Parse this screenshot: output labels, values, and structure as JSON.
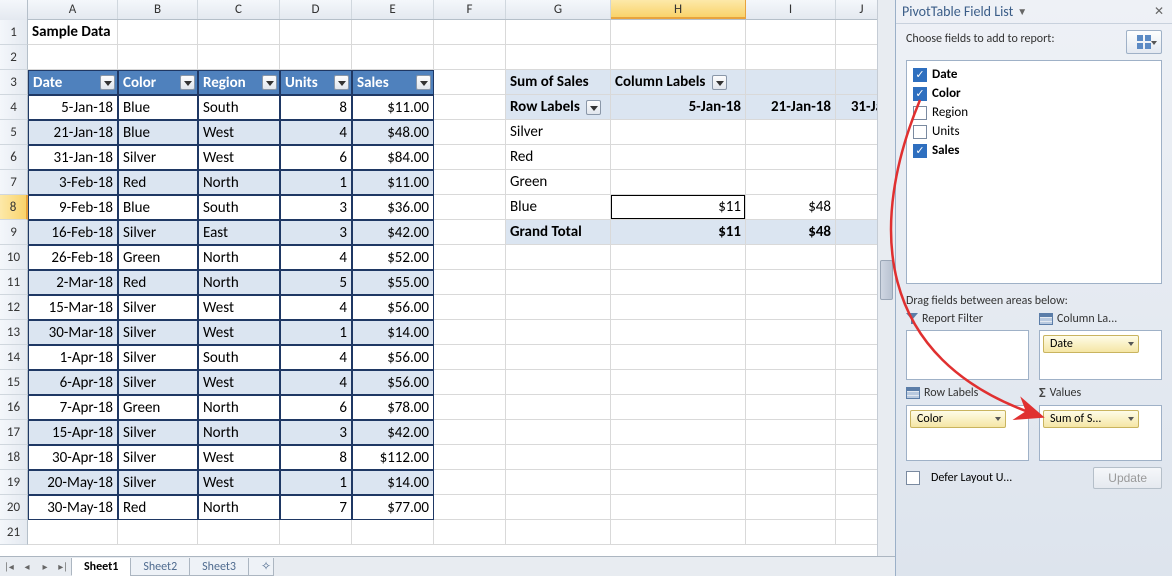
{
  "columns": [
    {
      "l": "A",
      "w": 90
    },
    {
      "l": "B",
      "w": 80
    },
    {
      "l": "C",
      "w": 82
    },
    {
      "l": "D",
      "w": 72
    },
    {
      "l": "E",
      "w": 82
    },
    {
      "l": "F",
      "w": 72
    },
    {
      "l": "G",
      "w": 105,
      "pv": true
    },
    {
      "l": "H",
      "w": 135,
      "pv": true,
      "selected": true
    },
    {
      "l": "I",
      "w": 90,
      "pv": true
    },
    {
      "l": "J",
      "w": 52,
      "pv": true
    }
  ],
  "title_cell": "Sample Data",
  "table": {
    "headers": [
      "Date",
      "Color",
      "Region",
      "Units",
      "Sales"
    ],
    "rows": [
      {
        "date": "5-Jan-18",
        "color": "Blue",
        "region": "South",
        "units": "8",
        "sales": "$11.00",
        "alt": false
      },
      {
        "date": "21-Jan-18",
        "color": "Blue",
        "region": "West",
        "units": "4",
        "sales": "$48.00",
        "alt": true
      },
      {
        "date": "31-Jan-18",
        "color": "Silver",
        "region": "West",
        "units": "6",
        "sales": "$84.00",
        "alt": false
      },
      {
        "date": "3-Feb-18",
        "color": "Red",
        "region": "North",
        "units": "1",
        "sales": "$11.00",
        "alt": true
      },
      {
        "date": "9-Feb-18",
        "color": "Blue",
        "region": "South",
        "units": "3",
        "sales": "$36.00",
        "alt": false
      },
      {
        "date": "16-Feb-18",
        "color": "Silver",
        "region": "East",
        "units": "3",
        "sales": "$42.00",
        "alt": true
      },
      {
        "date": "26-Feb-18",
        "color": "Green",
        "region": "North",
        "units": "4",
        "sales": "$52.00",
        "alt": false
      },
      {
        "date": "2-Mar-18",
        "color": "Red",
        "region": "North",
        "units": "5",
        "sales": "$55.00",
        "alt": true
      },
      {
        "date": "15-Mar-18",
        "color": "Silver",
        "region": "West",
        "units": "4",
        "sales": "$56.00",
        "alt": false
      },
      {
        "date": "30-Mar-18",
        "color": "Silver",
        "region": "West",
        "units": "1",
        "sales": "$14.00",
        "alt": true
      },
      {
        "date": "1-Apr-18",
        "color": "Silver",
        "region": "South",
        "units": "4",
        "sales": "$56.00",
        "alt": false
      },
      {
        "date": "6-Apr-18",
        "color": "Silver",
        "region": "West",
        "units": "4",
        "sales": "$56.00",
        "alt": true
      },
      {
        "date": "7-Apr-18",
        "color": "Green",
        "region": "North",
        "units": "6",
        "sales": "$78.00",
        "alt": false
      },
      {
        "date": "15-Apr-18",
        "color": "Silver",
        "region": "North",
        "units": "3",
        "sales": "$42.00",
        "alt": true
      },
      {
        "date": "30-Apr-18",
        "color": "Silver",
        "region": "West",
        "units": "8",
        "sales": "$112.00",
        "alt": false
      },
      {
        "date": "20-May-18",
        "color": "Silver",
        "region": "West",
        "units": "1",
        "sales": "$14.00",
        "alt": true
      },
      {
        "date": "30-May-18",
        "color": "Red",
        "region": "North",
        "units": "7",
        "sales": "$77.00",
        "alt": false
      }
    ]
  },
  "pivot": {
    "sum_label": "Sum of Sales",
    "col_label": "Column Labels",
    "row_label": "Row Labels",
    "col_dates": [
      "5-Jan-18",
      "21-Jan-18",
      "31-Ja"
    ],
    "rows": [
      "Silver",
      "Red",
      "Green",
      "Blue"
    ],
    "blue_vals": [
      "$11",
      "$48"
    ],
    "grand": "Grand Total",
    "grand_vals": [
      "$11",
      "$48"
    ]
  },
  "panel": {
    "title": "PivotTable Field List",
    "choose": "Choose fields to add to report:",
    "fields": [
      {
        "name": "Date",
        "checked": true
      },
      {
        "name": "Color",
        "checked": true
      },
      {
        "name": "Region",
        "checked": false
      },
      {
        "name": "Units",
        "checked": false
      },
      {
        "name": "Sales",
        "checked": true
      }
    ],
    "drag_label": "Drag fields between areas below:",
    "areas": {
      "report_filter": "Report Filter",
      "column_labels": "Column La...",
      "row_labels": "Row Labels",
      "values": "Values"
    },
    "chips": {
      "col": "Date",
      "row": "Color",
      "val": "Sum of S..."
    },
    "defer": "Defer Layout U...",
    "update": "Update"
  },
  "sheets": [
    "Sheet1",
    "Sheet2",
    "Sheet3"
  ],
  "active_sheet": 0,
  "selected_row": 8
}
